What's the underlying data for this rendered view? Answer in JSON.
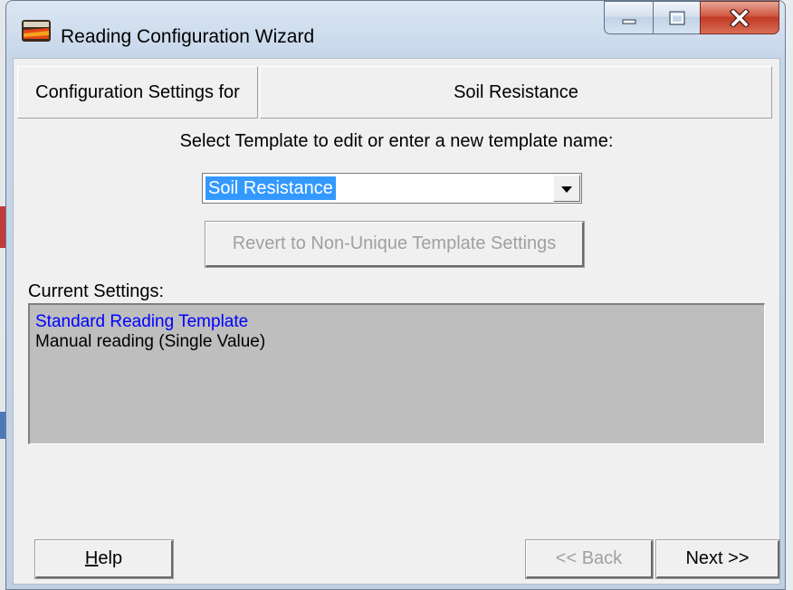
{
  "window": {
    "title": "Reading Configuration Wizard",
    "icon": "app-logo-icon",
    "controls": [
      "minimize-icon",
      "maximize-icon",
      "close-icon"
    ]
  },
  "header": {
    "label": "Configuration Settings for",
    "value": "Soil Resistance"
  },
  "template": {
    "prompt": "Select Template to edit or enter a new template name:",
    "selected": "Soil Resistance",
    "revert_label": "Revert to Non-Unique Template Settings"
  },
  "current": {
    "label": "Current Settings:",
    "lines": [
      "Standard Reading Template",
      "Manual reading (Single Value)"
    ]
  },
  "buttons": {
    "help_prefix": "H",
    "help_rest": "elp",
    "back": "<< Back",
    "next": "Next >>"
  },
  "colors": {
    "selection": "#3399ff",
    "settings_bg": "#bebebe",
    "template_line": "#0000ff",
    "close_button": "#c13a25"
  }
}
